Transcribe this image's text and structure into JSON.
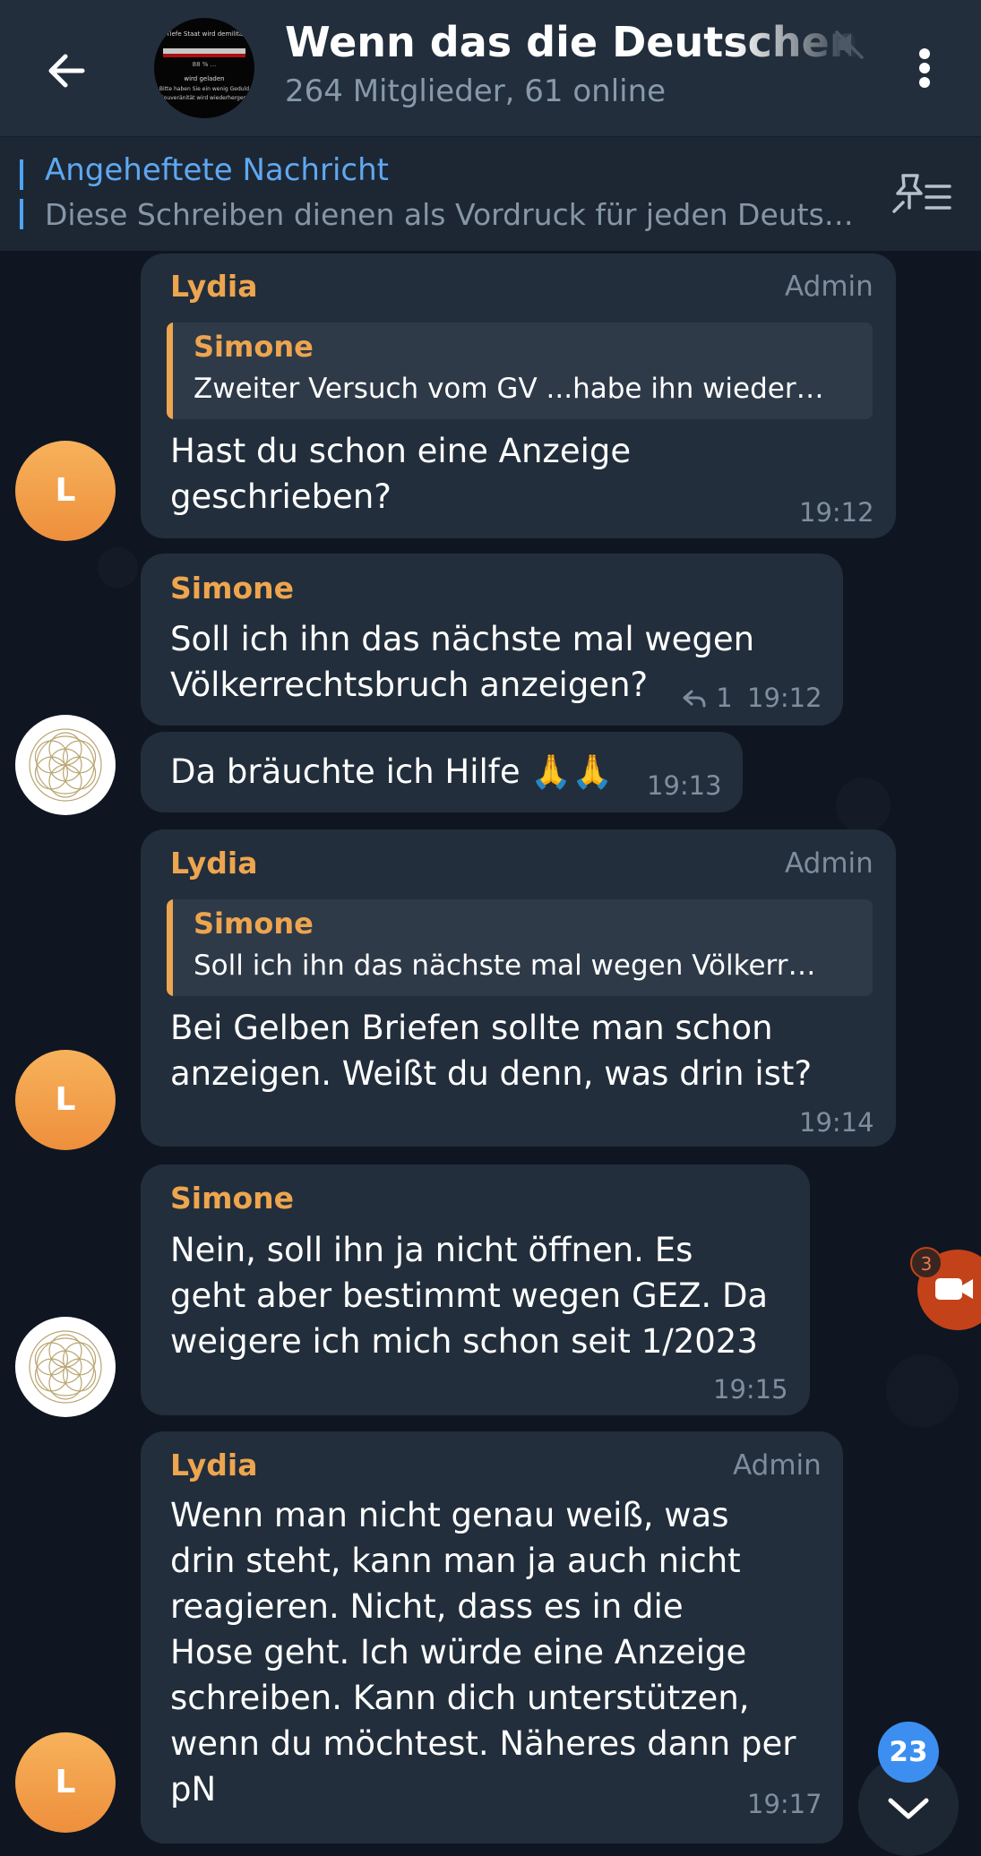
{
  "header": {
    "group_title": "Wenn das die Deutschen wü",
    "subtitle": "264 Mitglieder, 61 online",
    "avatar_text": {
      "line1": "er Tiefe Staat wird demilital...",
      "line2": "88 % ...",
      "line3": "wird geladen",
      "line4": "Bitte haben Sie ein wenig Geduld",
      "line5": "Souveränität wird wiederhergest"
    }
  },
  "pinned": {
    "title": "Angeheftete Nachricht",
    "text": "Diese Schreiben dienen als Vordruck für jeden Deutsc…"
  },
  "messages": [
    {
      "sender": "Lydia",
      "role": "Admin",
      "quote": {
        "name": "Simone",
        "text": "Zweiter Versuch vom GV ...habe ihn wieder…"
      },
      "text": "Hast du schon eine Anzeige\ngeschrieben?",
      "time": "19:12",
      "avatar_letter": "L"
    },
    {
      "sender": "Simone",
      "text": "Soll ich ihn das nächste mal wegen\nVölkerrechtsbruch anzeigen?",
      "replies": "1",
      "time": "19:12"
    },
    {
      "text": "Da bräuchte ich Hilfe 🙏🙏",
      "time": "19:13"
    },
    {
      "sender": "Lydia",
      "role": "Admin",
      "quote": {
        "name": "Simone",
        "text": "Soll ich ihn das nächste mal wegen Völkerr…"
      },
      "text": "Bei Gelben Briefen sollte man schon\nanzeigen. Weißt du denn, was drin ist?",
      "time": "19:14",
      "avatar_letter": "L"
    },
    {
      "sender": "Simone",
      "text": "Nein, soll ihn ja nicht öffnen.  Es\ngeht aber bestimmt wegen GEZ. Da\nweigere ich mich schon seit 1/2023",
      "time": "19:15"
    },
    {
      "sender": "Lydia",
      "role": "Admin",
      "text": "Wenn man nicht genau weiß,  was\ndrin steht, kann man ja auch nicht\nreagieren. Nicht, dass es in die\nHose geht. Ich würde eine Anzeige\nschreiben. Kann dich unterstützen,\nwenn du möchtest. Näheres dann per\npN",
      "time": "19:17",
      "avatar_letter": "L"
    }
  ],
  "floating": {
    "call_badge": "3",
    "unread_count": "23"
  },
  "icons": {
    "back": "arrow-left-icon",
    "mute": "speaker-muted-icon",
    "menu": "more-vertical-icon",
    "pinned_list": "pin-list-icon",
    "reply": "reply-arrow-icon",
    "video_call": "video-camera-icon",
    "scroll_down": "chevron-down-icon"
  },
  "colors": {
    "background": "#0f1621",
    "header": "#222e3c",
    "bubble": "#222e3b",
    "sender_accent": "#eda54f",
    "link_blue": "#5ea8f2",
    "badge_blue": "#3c8ff0",
    "call_orange": "#c4421a"
  }
}
